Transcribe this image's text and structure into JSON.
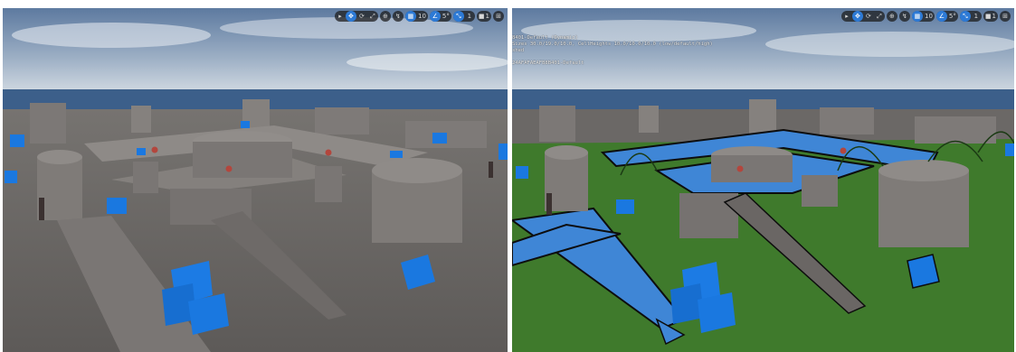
{
  "left_viewport": {
    "toolbar": {
      "select_icon": "cursor-icon",
      "translate_icon": "move-icon",
      "rotate_icon": "rotate-icon",
      "scale_icon": "scale-icon",
      "world_icon": "globe-icon",
      "surface_snap_icon": "surface-snap-icon",
      "grid_value": "10",
      "rotation_value": "5°",
      "scale_value": "1",
      "camera_value": "1"
    }
  },
  "right_viewport": {
    "toolbar": {
      "grid_value": "10",
      "rotation_value": "5°",
      "scale_value": "1",
      "camera_value": "1"
    },
    "stats_lines": [
      "8401-Default (Dynamic)",
      "Sizes 30.0/19.0/10.0, CellHeights 10.0/10.0/10.0 (low/default/high)",
      "shed"
    ],
    "stats_footer": "24AFAFAEAFB8B401-Default"
  },
  "colors": {
    "sky_top": "#6a86a8",
    "sky_horizon": "#c9d4de",
    "ocean": "#3c5f8a",
    "floor": "#6b6866",
    "navmesh_green": "#3f7a2c",
    "navmesh_blue": "#3f86d6",
    "cube_blue": "#1a78e0",
    "toolbar_active": "#2d7ad6"
  }
}
